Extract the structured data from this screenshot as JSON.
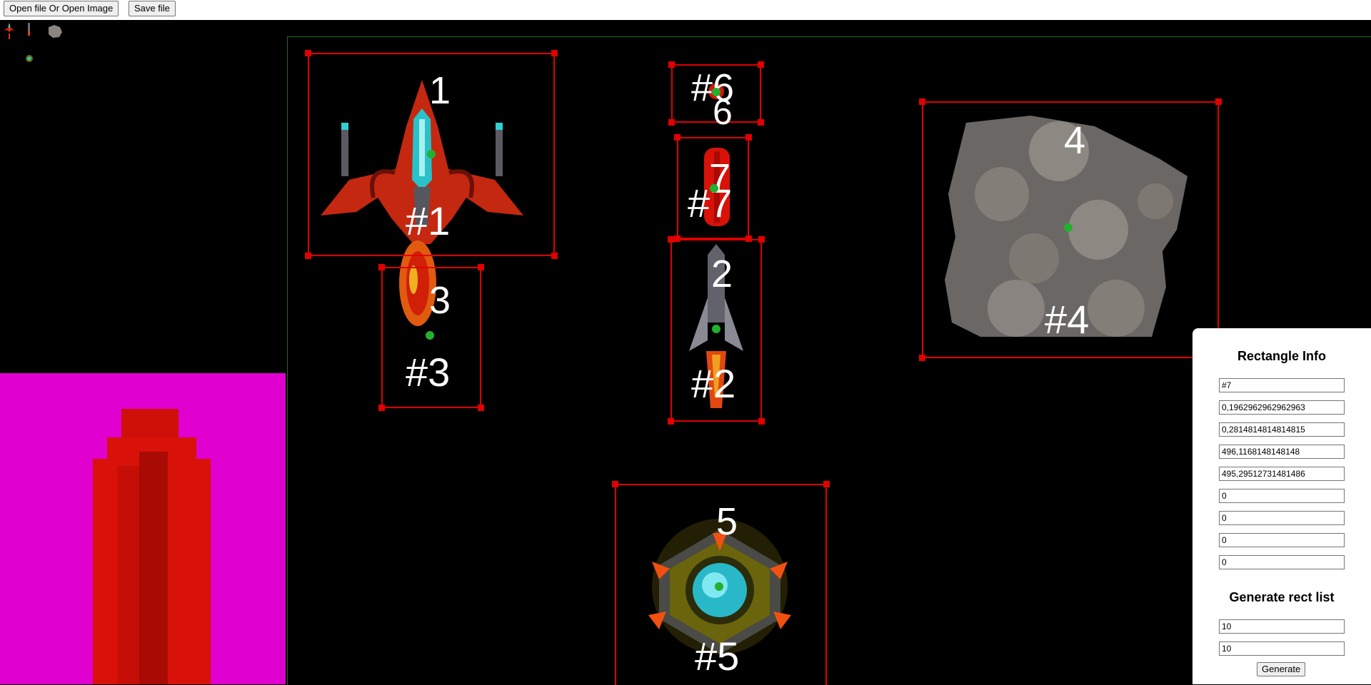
{
  "toolbar": {
    "open_label": "Open file Or Open Image",
    "save_label": "Save file"
  },
  "sprites": [
    {
      "id": "#1",
      "index": "1",
      "name": "red-fighter-ship"
    },
    {
      "id": "#2",
      "index": "2",
      "name": "rocket-missile"
    },
    {
      "id": "#3",
      "index": "3",
      "name": "fire-bullet"
    },
    {
      "id": "#4",
      "index": "4",
      "name": "asteroid-rock"
    },
    {
      "id": "#5",
      "index": "5",
      "name": "orb-turret"
    },
    {
      "id": "#6",
      "index": "6",
      "name": "small-red-bullet"
    },
    {
      "id": "#7",
      "index": "7",
      "name": "red-laser-bolt"
    }
  ],
  "panel": {
    "title": "Rectangle Info",
    "fields": [
      "#7",
      "0,1962962962962963",
      "0,2814814814814815",
      "496,1168148148148",
      "495,29512731481486",
      "0",
      "0",
      "0",
      "0"
    ],
    "generate_title": "Generate rect list",
    "generate_fields": [
      "10",
      "10"
    ],
    "generate_label": "Generate"
  },
  "colors": {
    "rect_border": "#e00000",
    "center_dot": "#22b030",
    "preview_background": "#e000d0",
    "canvas_border": "#1e6b1e"
  }
}
